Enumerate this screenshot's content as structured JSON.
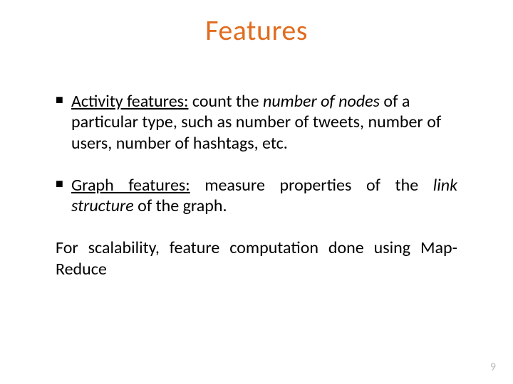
{
  "colors": {
    "title": "#E06C1E",
    "text": "#000000",
    "pageNumber": "#BFBFBF"
  },
  "title": "Features",
  "bullets": {
    "b1": {
      "label": "Activity features:",
      "pre": " count the ",
      "italic": "number of nodes",
      "post": " of a particular type, such as number of tweets, number of users, number of hashtags, etc."
    },
    "b2": {
      "label": "Graph features:",
      "pre": " measure properties of the ",
      "italic": "link structure",
      "post": " of the graph."
    },
    "b3": {
      "text": "For scalability, feature computation done using Map-Reduce"
    }
  },
  "pageNumber": "9",
  "bulletGlyph": "■"
}
